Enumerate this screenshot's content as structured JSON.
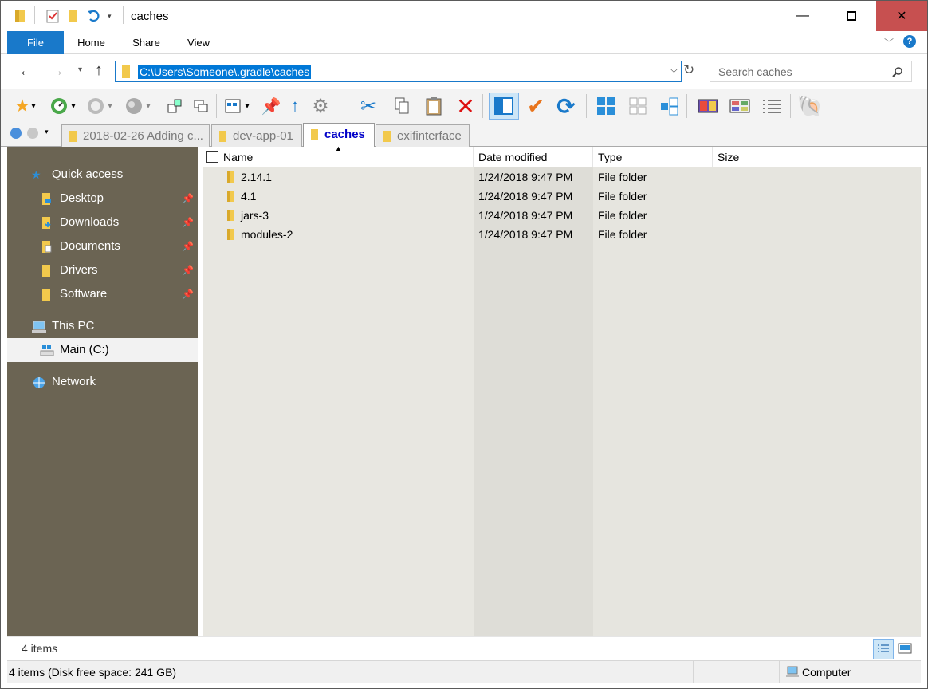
{
  "window": {
    "title": "caches"
  },
  "title_controls": {
    "minimize": "—",
    "maximize": "▢",
    "close": "✕"
  },
  "ribbon": {
    "tabs": [
      "File",
      "Home",
      "Share",
      "View"
    ]
  },
  "address": {
    "path": "C:\\Users\\Someone\\.gradle\\caches"
  },
  "search": {
    "placeholder": "Search caches"
  },
  "folder_tabs": [
    {
      "label": "2018-02-26 Adding c..."
    },
    {
      "label": "dev-app-01"
    },
    {
      "label": "caches"
    },
    {
      "label": "exifinterface"
    }
  ],
  "nav": {
    "quick_access": "Quick access",
    "pinned": [
      "Desktop",
      "Downloads",
      "Documents",
      "Drivers",
      "Software"
    ],
    "this_pc": "This PC",
    "drive": "Main (C:)",
    "network": "Network"
  },
  "columns": [
    "Name",
    "Date modified",
    "Type",
    "Size"
  ],
  "files": [
    {
      "name": "2.14.1",
      "date": "1/24/2018 9:47 PM",
      "type": "File folder",
      "size": ""
    },
    {
      "name": "4.1",
      "date": "1/24/2018 9:47 PM",
      "type": "File folder",
      "size": ""
    },
    {
      "name": "jars-3",
      "date": "1/24/2018 9:47 PM",
      "type": "File folder",
      "size": ""
    },
    {
      "name": "modules-2",
      "date": "1/24/2018 9:47 PM",
      "type": "File folder",
      "size": ""
    }
  ],
  "status": {
    "item_count": "4 items",
    "disk_info": "4 items (Disk free space: 241 GB)",
    "location": "Computer"
  },
  "colors": {
    "accent": "#1979ca",
    "nav_bg": "#6b6453",
    "close_bg": "#c75050",
    "folder": "#f2c94c"
  }
}
